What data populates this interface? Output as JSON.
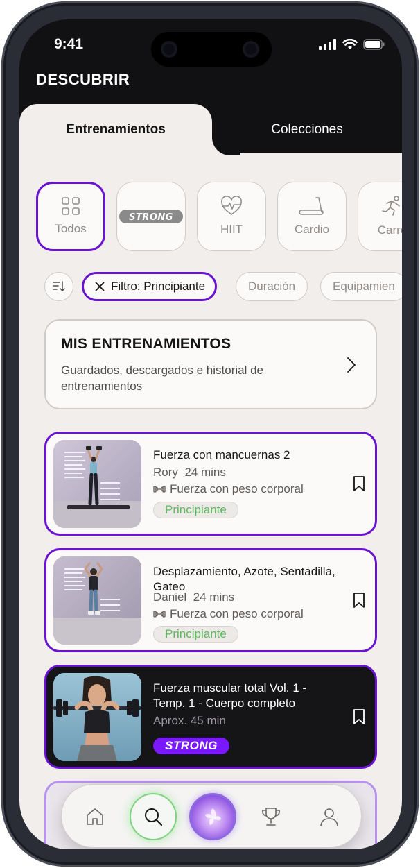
{
  "status_bar": {
    "time": "9:41"
  },
  "header": {
    "title": "DESCUBRIR"
  },
  "tabs": [
    {
      "label": "Entrenamientos",
      "active": true
    },
    {
      "label": "Colecciones",
      "active": false
    }
  ],
  "categories": [
    {
      "label": "Todos",
      "icon": "grid-icon",
      "active": true
    },
    {
      "label": "STRONG",
      "icon": "strong-logo",
      "active": false
    },
    {
      "label": "HIIT",
      "icon": "heart-pulse-icon",
      "active": false
    },
    {
      "label": "Cardio",
      "icon": "treadmill-icon",
      "active": false
    },
    {
      "label": "Carre",
      "icon": "runner-icon",
      "active": false
    }
  ],
  "filters": {
    "sort_icon": "sort-icon",
    "chips": [
      {
        "label": "Filtro: Principiante",
        "active": true
      },
      {
        "label": "Duración",
        "active": false
      },
      {
        "label": "Equipamien",
        "active": false
      }
    ]
  },
  "my_workouts": {
    "title": "MIS ENTRENAMIENTOS",
    "description": "Guardados, descargados e historial de entrenamientos"
  },
  "workouts": [
    {
      "title": "Fuerza con mancuernas 2",
      "trainer": "Rory",
      "duration": "24 mins",
      "type": "Fuerza con peso corporal",
      "level": "Principiante"
    },
    {
      "title": "Desplazamiento, Azote, Sentadilla, Gateo",
      "trainer": "Daniel",
      "duration": "24 mins",
      "type": "Fuerza con peso corporal",
      "level": "Principiante"
    },
    {
      "title": "Fuerza muscular total Vol. 1 - Temp. 1 - Cuerpo completo",
      "duration": "Aprox. 45 min",
      "brand": "STRONG"
    }
  ],
  "nav": {
    "items": [
      {
        "icon": "home-icon",
        "active": false
      },
      {
        "icon": "search-icon",
        "active": true
      },
      {
        "icon": "coach-orb-icon",
        "active": false
      },
      {
        "icon": "trophy-icon",
        "active": false
      },
      {
        "icon": "profile-icon",
        "active": false
      }
    ]
  },
  "colors": {
    "accent": "#6a14d1",
    "strong_purple": "#7a18ff",
    "level_green": "#5cb85c",
    "background": "#f1eeeb",
    "dark": "#111012"
  }
}
